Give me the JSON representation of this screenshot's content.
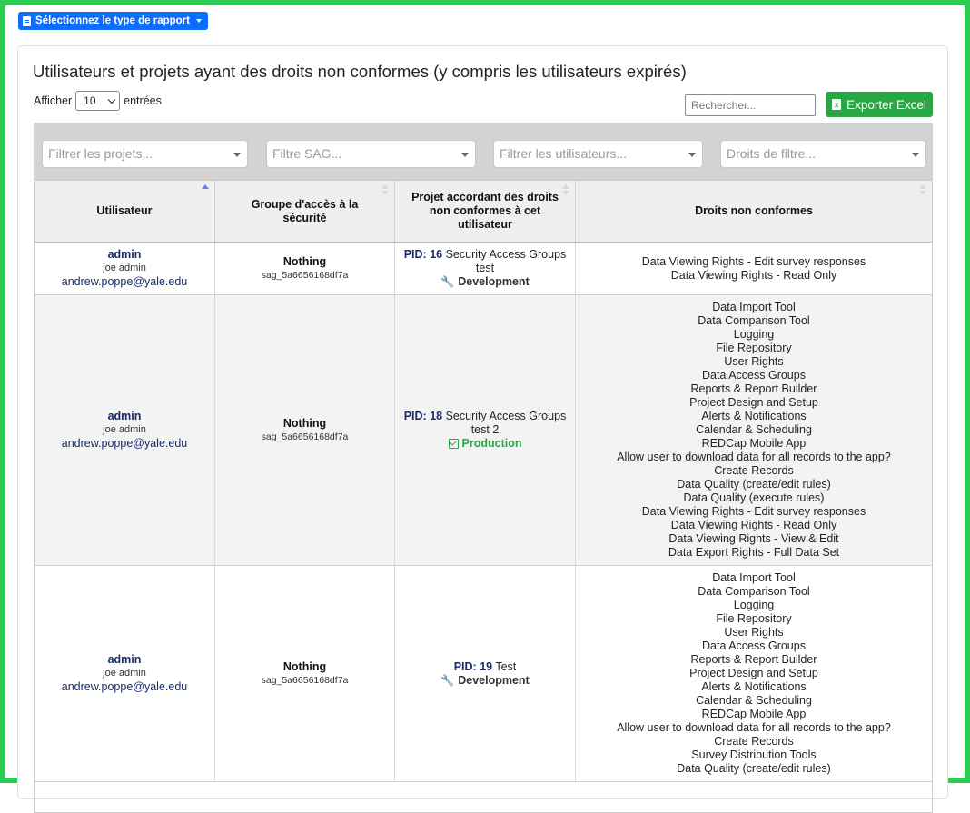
{
  "report_button": {
    "label": "Sélectionnez le type de rapport",
    "icon": "file-icon"
  },
  "card": {
    "title": "Utilisateurs et projets ayant des droits non conformes (y compris les utilisateurs expirés)"
  },
  "length_control": {
    "prefix": "Afficher",
    "value": "10",
    "suffix": "entrées"
  },
  "search": {
    "placeholder": "Rechercher..."
  },
  "export": {
    "label": "Exporter Excel",
    "icon": "excel-icon"
  },
  "filters": {
    "projects": "Filtrer les projets...",
    "sag": "Filtre SAG...",
    "users": "Filtrer les utilisateurs...",
    "rights": "Droits de filtre..."
  },
  "columns": {
    "user": "Utilisateur",
    "sag": "Groupe d'accès à la sécurité",
    "project": "Projet accordant des droits non conformes à cet utilisateur",
    "rights": "Droits non conformes"
  },
  "rows": [
    {
      "username": "admin",
      "fullname": "joe admin",
      "email": "andrew.poppe@yale.edu",
      "sag_name": "Nothing",
      "sag_id": "sag_5a6656168df7a",
      "pid_label": "PID:",
      "pid": "16",
      "project_name": "Security Access Groups test",
      "status": "Development",
      "rights": [
        "Data Viewing Rights - Edit survey responses",
        "Data Viewing Rights - Read Only"
      ]
    },
    {
      "username": "admin",
      "fullname": "joe admin",
      "email": "andrew.poppe@yale.edu",
      "sag_name": "Nothing",
      "sag_id": "sag_5a6656168df7a",
      "pid_label": "PID:",
      "pid": "18",
      "project_name": "Security Access Groups test 2",
      "status": "Production",
      "rights": [
        "Data Import Tool",
        "Data Comparison Tool",
        "Logging",
        "File Repository",
        "User Rights",
        "Data Access Groups",
        "Reports & Report Builder",
        "Project Design and Setup",
        "Alerts & Notifications",
        "Calendar & Scheduling",
        "REDCap Mobile App",
        "Allow user to download data for all records to the app?",
        "Create Records",
        "Data Quality (create/edit rules)",
        "Data Quality (execute rules)",
        "Data Viewing Rights - Edit survey responses",
        "Data Viewing Rights - Read Only",
        "Data Viewing Rights - View & Edit",
        "Data Export Rights - Full Data Set"
      ]
    },
    {
      "username": "admin",
      "fullname": "joe admin",
      "email": "andrew.poppe@yale.edu",
      "sag_name": "Nothing",
      "sag_id": "sag_5a6656168df7a",
      "pid_label": "PID:",
      "pid": "19",
      "project_name": "Test",
      "status": "Development",
      "rights": [
        "Data Import Tool",
        "Data Comparison Tool",
        "Logging",
        "File Repository",
        "User Rights",
        "Data Access Groups",
        "Reports & Report Builder",
        "Project Design and Setup",
        "Alerts & Notifications",
        "Calendar & Scheduling",
        "REDCap Mobile App",
        "Allow user to download data for all records to the app?",
        "Create Records",
        "Survey Distribution Tools",
        "Data Quality (create/edit rules)"
      ]
    }
  ],
  "colors": {
    "accent": "#0d6efd",
    "export": "#28a745",
    "frame": "#2ecc55",
    "name_text": "#1a2a6c"
  }
}
